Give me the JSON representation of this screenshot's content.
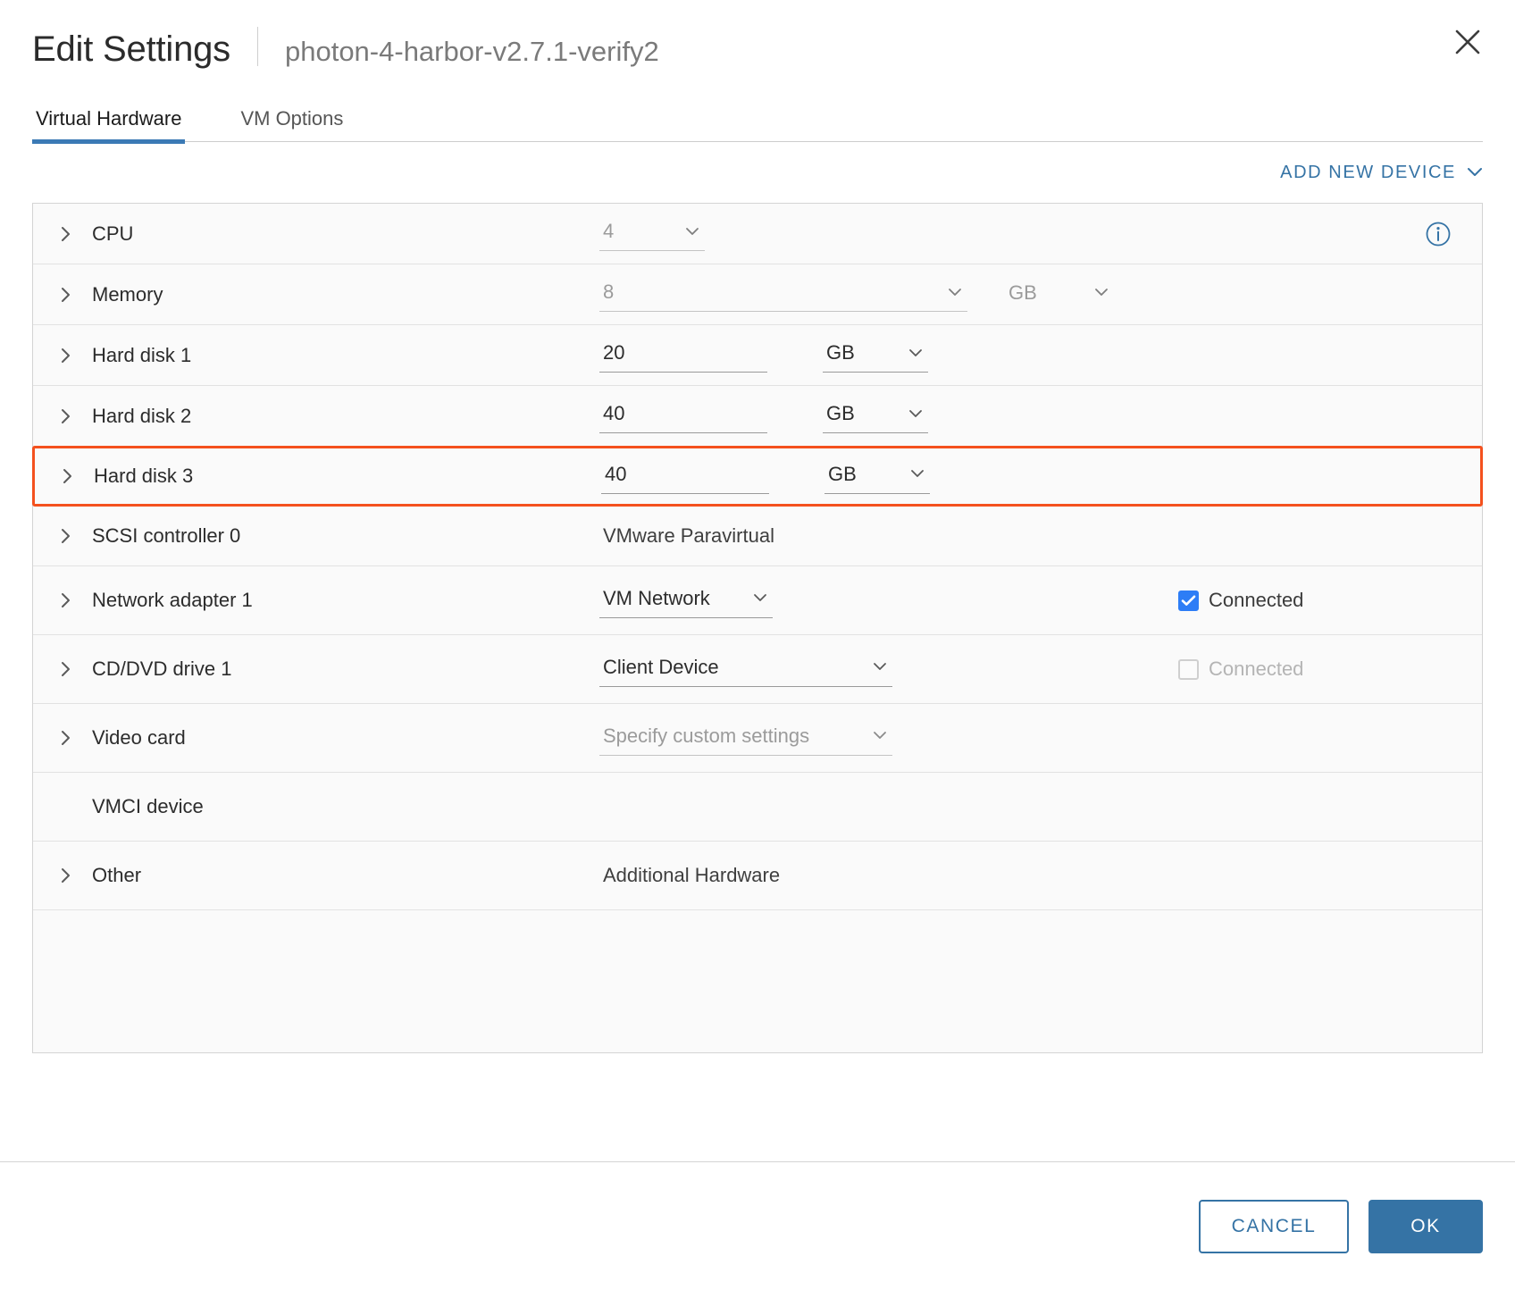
{
  "header": {
    "title": "Edit Settings",
    "vm_name": "photon-4-harbor-v2.7.1-verify2",
    "close_icon": "close-icon"
  },
  "tabs": [
    {
      "label": "Virtual Hardware",
      "active": true
    },
    {
      "label": "VM Options",
      "active": false
    }
  ],
  "toolbar": {
    "add_new_device_label": "ADD NEW DEVICE",
    "add_new_device_caret": "chevron-down-icon"
  },
  "colors": {
    "accent_blue": "#3573a5",
    "checkbox_blue": "#2d7df6",
    "highlight_orange": "#f4511e",
    "tab_underline": "#3b7ab5",
    "row_background": "#fafafa"
  },
  "rows": {
    "cpu": {
      "label": "CPU",
      "value": "4",
      "has_info_icon": true,
      "info_icon": "info-circle-icon"
    },
    "memory": {
      "label": "Memory",
      "value": "8",
      "unit": "GB"
    },
    "hard_disk_1": {
      "label": "Hard disk 1",
      "value": "20",
      "unit": "GB"
    },
    "hard_disk_2": {
      "label": "Hard disk 2",
      "value": "40",
      "unit": "GB"
    },
    "hard_disk_3": {
      "label": "Hard disk 3",
      "value": "40",
      "unit": "GB",
      "highlighted": true
    },
    "scsi_controller_0": {
      "label": "SCSI controller 0",
      "value": "VMware Paravirtual"
    },
    "network_adapter_1": {
      "label": "Network adapter 1",
      "value": "VM Network",
      "connected_label": "Connected",
      "connected": true
    },
    "cd_dvd_drive_1": {
      "label": "CD/DVD drive 1",
      "value": "Client Device",
      "connected_label": "Connected",
      "connected": false
    },
    "video_card": {
      "label": "Video card",
      "value": "Specify custom settings"
    },
    "vmci_device": {
      "label": "VMCI device"
    },
    "other": {
      "label": "Other",
      "value": "Additional Hardware"
    }
  },
  "footer": {
    "cancel_label": "CANCEL",
    "ok_label": "OK"
  }
}
